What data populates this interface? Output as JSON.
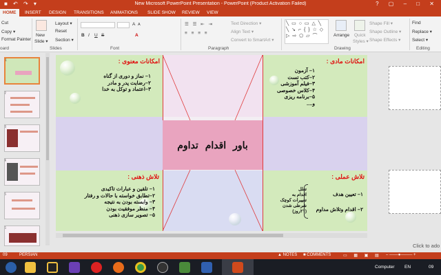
{
  "window": {
    "title": "New Microsoft PowerPoint Presentation - PowerPoint (Product Activation Failed)",
    "quick_access": "■ ↶ ↷ ▾",
    "controls": "? ▢ – □ ✕"
  },
  "tabs": [
    "HOME",
    "INSERT",
    "DESIGN",
    "TRANSITIONS",
    "ANIMATIONS",
    "SLIDE SHOW",
    "REVIEW",
    "VIEW"
  ],
  "ribbon": {
    "clipboard": {
      "cut": "Cut",
      "copy": "Copy ▾",
      "format_painter": "Format Painter",
      "group": "oard"
    },
    "slides": {
      "new_slide": "New",
      "new_slide2": "Slide ▾",
      "layout": "Layout ▾",
      "reset": "Reset",
      "section": "Section ▾",
      "group": "Slides"
    },
    "font": {
      "group": "Font",
      "bold": "B",
      "italic": "I",
      "underline": "U",
      "strike": "S",
      "size_up": "A",
      "size_down": "A",
      "font_color": "A"
    },
    "paragraph": {
      "group": "Paragraph",
      "text_direction": "Text Direction ▾",
      "align_text": "Align Text ▾",
      "smartart": "Convert to SmartArt ▾"
    },
    "drawing": {
      "group": "Drawing",
      "arrange": "Arrange",
      "quick_styles": "Quick",
      "quick_styles2": "Styles ▾",
      "shape_fill": "Shape Fill ▾",
      "shape_outline": "Shape Outline ▾",
      "shape_effects": "Shape Effects ▾",
      "shapes_gallery": "╲ ▭ ○ ▭ △ ╲ ╲ ↘ ⌐ { } ☆ ◇ ▷ ⇨ ⬠ ▱ ⌒"
    },
    "editing": {
      "group": "Editing",
      "find": "Find",
      "replace": "Replace ▾",
      "select": "Select ▾"
    }
  },
  "thumbs": [
    "1",
    "2",
    "3",
    "4",
    "5",
    "6"
  ],
  "slide": {
    "center": "باور   اقدام   تداوم",
    "q_spiritual": {
      "title": "امکانات معنوی :",
      "items": [
        "۱– نماز و دوری از گناه",
        "۲–رضایت پدر و مادر",
        "۳–اعتماد و توکل به خدا"
      ]
    },
    "q_material": {
      "title": "امکانات مادی :",
      "items": [
        "۱– آزمون",
        "۲–کتب تست",
        "۳–فیلم آموزشی",
        "۴–کلاس خصوصی",
        "۵–برنامه ریزی",
        "و...."
      ]
    },
    "q_mental": {
      "title": "تلاش ذهنی :",
      "items": [
        "۱– تلقین و عبارات تاکیدی",
        "۲–تطابق خواسته با حالات و رفتار",
        "۳– وابسته بودن به نتیجه",
        "۴– منظر موفقیت بودن",
        "۵– تصویر سازی ذهنی"
      ]
    },
    "q_practical": {
      "title": "تلاش عملی :",
      "items": [
        "۱– تعیین هدف",
        "۲– اقدام وتلاش مداوم"
      ]
    },
    "side_note": [
      "تعلل",
      "اقدام به",
      "تغییرات کوچک",
      "شرطی شدن",
      "(۲۱روز)"
    ]
  },
  "notes_hint": "Click to ado",
  "status": {
    "slide": "09",
    "language": "PERSIAN",
    "notes": "▲ NOTES",
    "comments": "■ COMMENTS"
  },
  "taskbar": {
    "computer": "Computer",
    "lang": "EN",
    "time": "09"
  }
}
